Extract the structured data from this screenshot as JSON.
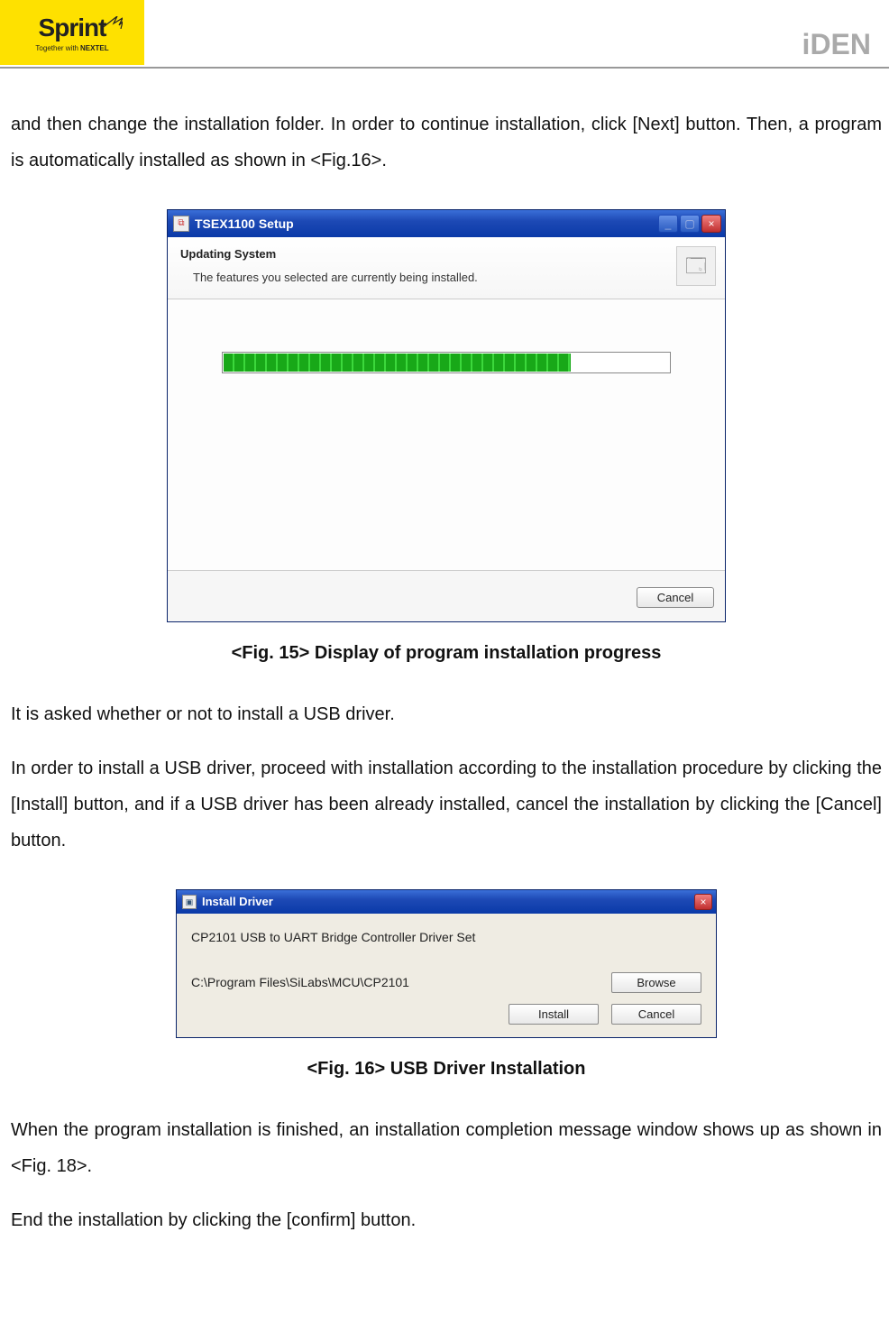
{
  "header": {
    "logo_main": "Sprint",
    "logo_tag_prefix": "Together with",
    "logo_tag_brand": "NEXTEL",
    "brand_right": "iDEN"
  },
  "para1": "and then change the installation folder. In order to continue installation, click [Next] button. Then, a program is automatically installed as shown in <Fig.16>.",
  "fig15": {
    "titlebar_title": "TSEX1100 Setup",
    "heading": "Updating System",
    "subheading": "The features you selected are currently being installed.",
    "progress_percent": 78,
    "footer_button": "Cancel",
    "caption": "<Fig. 15> Display of program installation progress"
  },
  "para2a": "It is asked whether or not to install a USB driver.",
  "para2b": "In order to install a USB driver, proceed with installation according to the installation procedure by clicking the [Install] button, and if a USB driver has been already installed, cancel the installation by clicking the [Cancel] button.",
  "fig16": {
    "titlebar_title": "Install Driver",
    "line1": "CP2101 USB to UART Bridge Controller Driver Set",
    "path": "C:\\Program Files\\SiLabs\\MCU\\CP2101",
    "btn_browse": "Browse",
    "btn_install": "Install",
    "btn_cancel": "Cancel",
    "caption": "<Fig. 16> USB Driver Installation"
  },
  "para3a": "When the program installation is finished, an installation completion message window shows up as shown in <Fig. 18>.",
  "para3b": "End the installation by clicking the [confirm] button."
}
